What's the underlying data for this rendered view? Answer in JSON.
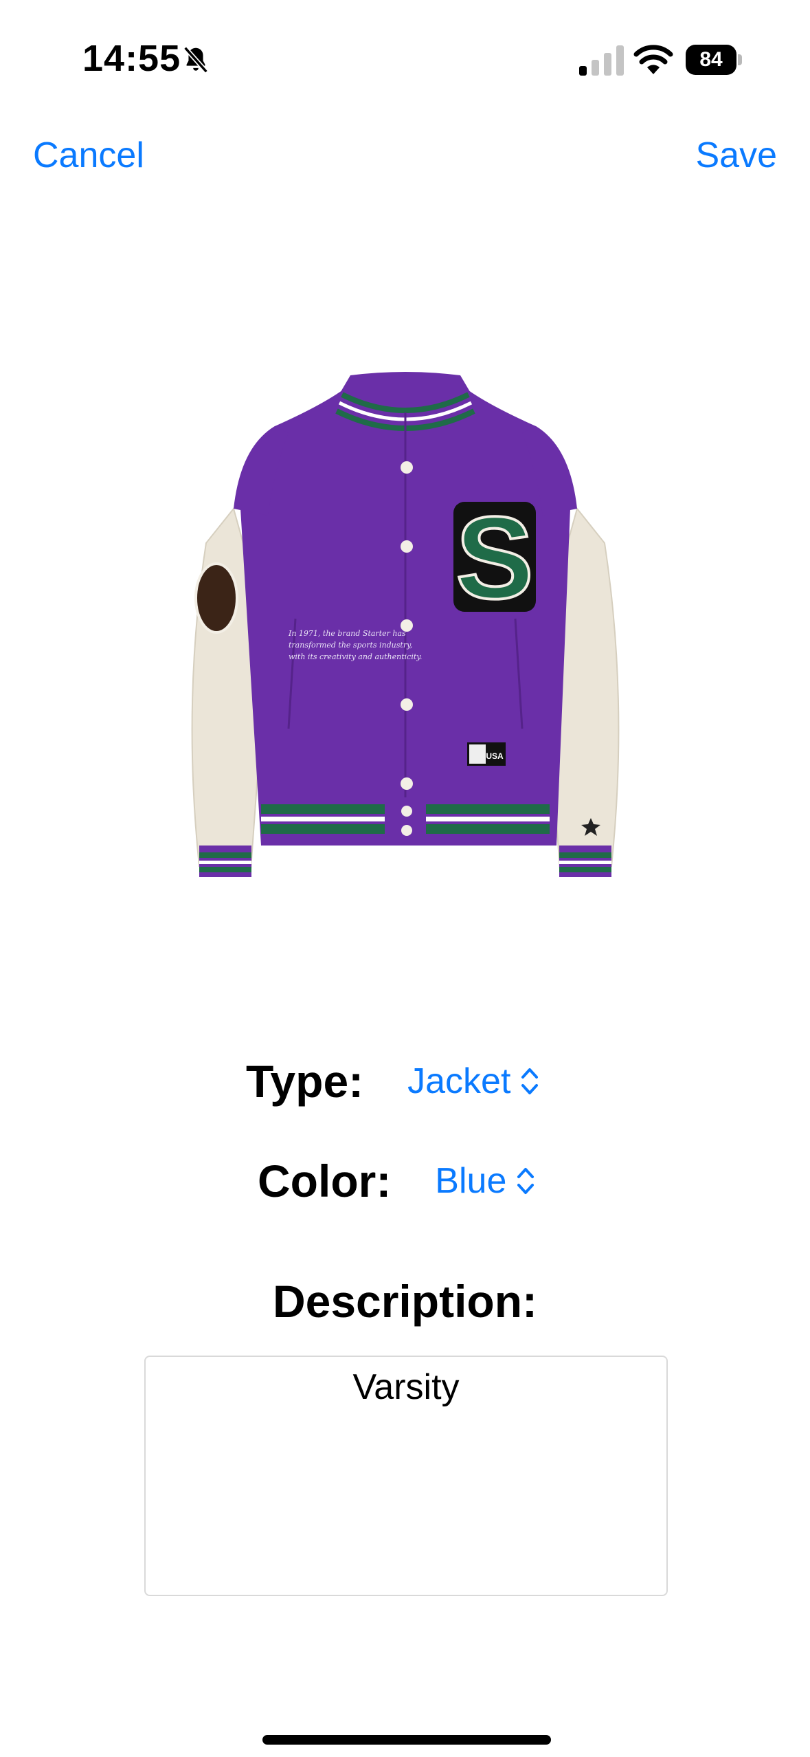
{
  "status_bar": {
    "time": "14:55",
    "battery": "84"
  },
  "nav": {
    "cancel_label": "Cancel",
    "save_label": "Save"
  },
  "jacket_image": {
    "logo_letter": "S",
    "patch_text": "USA",
    "script_line_1": "In 1971, the brand Starter has",
    "script_line_2": "transformed the sports industry,",
    "script_line_3": "with its creativity and authenticity."
  },
  "form": {
    "type_label": "Type:",
    "type_value": "Jacket",
    "color_label": "Color:",
    "color_value": "Blue",
    "description_label": "Description:",
    "description_value": "Varsity"
  },
  "colors": {
    "accent": "#0a7aff",
    "jacket_body": "#6a2fa8",
    "jacket_sleeves": "#ebe5d8",
    "jacket_stripe_green": "#1f6b48"
  }
}
